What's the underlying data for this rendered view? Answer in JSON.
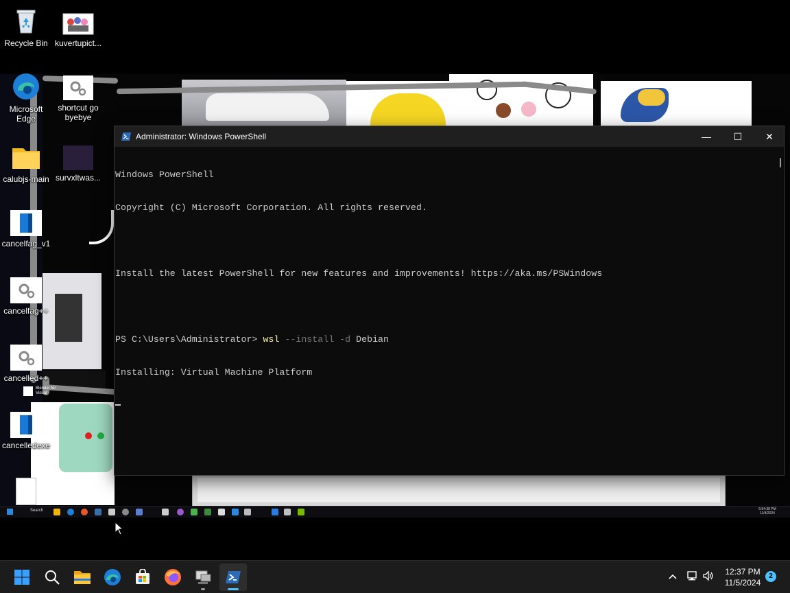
{
  "desktop_icons": [
    {
      "label": "Recycle Bin",
      "icon": "recycle-bin-icon"
    },
    {
      "label": "kuvertupict...",
      "icon": "image-file-icon"
    }
  ],
  "wallpaper_icons": [
    {
      "label": "Microsoft Edge"
    },
    {
      "label": "shortcut go byebye"
    },
    {
      "label": "calubjs-main"
    },
    {
      "label": "survxltwas..."
    },
    {
      "label": "cancelfag_v1"
    },
    {
      "label": "cancelfag++"
    },
    {
      "label": "cancelled++"
    },
    {
      "label": "cancelledexe"
    },
    {
      "label": "info"
    },
    {
      "label": "Blender for Visual"
    }
  ],
  "powershell": {
    "title": "Administrator: Windows PowerShell",
    "lines": {
      "l1": "Windows PowerShell",
      "l2": "Copyright (C) Microsoft Corporation. All rights reserved.",
      "l3": "Install the latest PowerShell for new features and improvements! https://aka.ms/PSWindows",
      "prompt": "PS C:\\Users\\Administrator> ",
      "cmd": "wsl",
      "args": " --install -d ",
      "distro": "Debian",
      "l5": "Installing: Virtual Machine Platform"
    },
    "controls": {
      "minimize": "—",
      "maximize": "☐",
      "close": "✕"
    }
  },
  "mini_taskbar": {
    "search": "Search",
    "clock_time": "6:54:38 PM",
    "clock_date": "11/4/2024"
  },
  "taskbar": {
    "apps": [
      {
        "name": "start",
        "icon": "windows-logo-icon"
      },
      {
        "name": "search",
        "icon": "search-icon"
      },
      {
        "name": "file-explorer",
        "icon": "folder-icon"
      },
      {
        "name": "edge",
        "icon": "edge-icon"
      },
      {
        "name": "store",
        "icon": "store-icon"
      },
      {
        "name": "firefox",
        "icon": "firefox-icon"
      },
      {
        "name": "remote",
        "icon": "remote-desktop-icon"
      },
      {
        "name": "powershell",
        "icon": "powershell-icon",
        "active": true
      }
    ],
    "clock_time": "12:37 PM",
    "clock_date": "11/5/2024",
    "notification_count": "2"
  },
  "colors": {
    "taskbar_bg": "#1c1c1c",
    "accent": "#4cc2ff",
    "terminal_bg": "#0c0c0c",
    "terminal_fg": "#cccccc",
    "cmd_yellow": "#f9f1a5",
    "cmd_gray": "#767676"
  }
}
